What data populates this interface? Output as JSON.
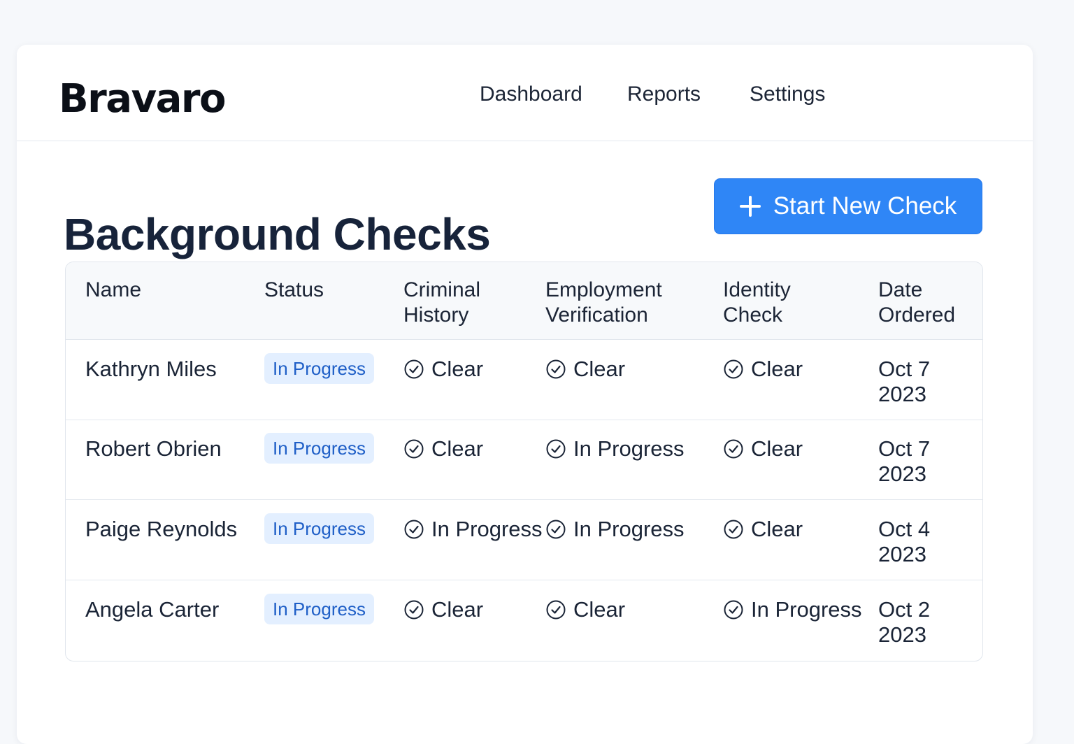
{
  "app": {
    "logo": "Bravaro"
  },
  "nav": {
    "dashboard": "Dashboard",
    "reports": "Reports",
    "settings": "Settings"
  },
  "page": {
    "title": "Background Checks",
    "primary_button": "Start New Check"
  },
  "table": {
    "headers": {
      "name": "Name",
      "status": "Status",
      "criminal": "Criminal\nHistory",
      "employment": "Employment\nVerification",
      "identity": "Identity\nCheck",
      "date": "Date\nOrdered"
    },
    "rows": [
      {
        "name": "Kathryn Miles",
        "status": "In Progress",
        "criminal": "Clear",
        "employment": "Clear",
        "identity": "Clear",
        "date": "Oct 7\n2023"
      },
      {
        "name": "Robert Obrien",
        "status": "In Progress",
        "criminal": "Clear",
        "employment": "In Progress",
        "identity": "Clear",
        "date": "Oct 7\n2023"
      },
      {
        "name": "Paige Reynolds",
        "status": "In Progress",
        "criminal": "In Progress",
        "employment": "In Progress",
        "identity": "Clear",
        "date": "Oct 4\n2023"
      },
      {
        "name": "Angela Carter",
        "status": "In Progress",
        "criminal": "Clear",
        "employment": "Clear",
        "identity": "In Progress",
        "date": "Oct 2\n2023"
      }
    ]
  },
  "colors": {
    "accent": "#2f86f6",
    "badge_bg": "#e3efff",
    "badge_text": "#1f5fc7"
  },
  "icons": {
    "check": "check-circle-icon",
    "plus": "plus-icon"
  }
}
